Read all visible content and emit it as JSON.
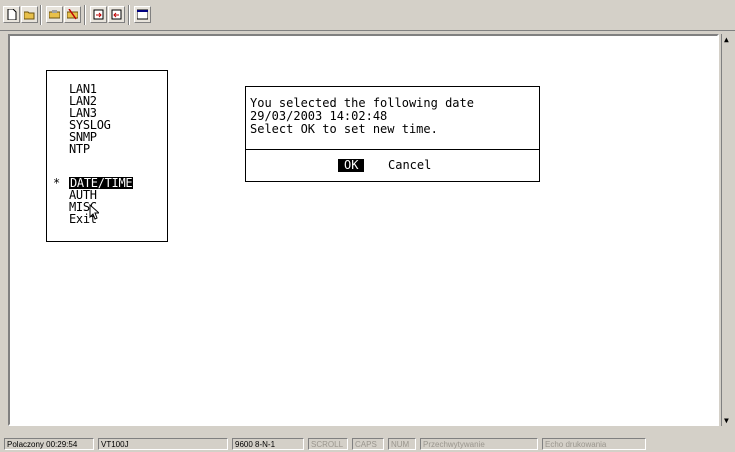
{
  "toolbar": {
    "buttons": [
      "new-icon",
      "open-icon",
      "connect-icon",
      "disconnect-icon",
      "send-icon",
      "receive-icon",
      "properties-icon"
    ]
  },
  "menu": {
    "marker": "*",
    "items": [
      "LAN1",
      "LAN2",
      "LAN3",
      "SYSLOG",
      "SNMP",
      "NTP",
      "DATE/TIME",
      "AUTH",
      "MISC",
      "Exit"
    ],
    "selected_index": 6
  },
  "dialog": {
    "line1": "You selected the following date",
    "line2": "29/03/2003 14:02:48",
    "line3": "Select OK to set new time.",
    "ok_label": "OK",
    "cancel_label": "Cancel"
  },
  "statusbar": {
    "connected": "Polaczony 00:29:54",
    "emulation": "VT100J",
    "settings": "9600 8-N-1",
    "scroll": "SCROLL",
    "caps": "CAPS",
    "num": "NUM",
    "capture": "Przechwytywanie",
    "echo": "Echo drukowania"
  }
}
